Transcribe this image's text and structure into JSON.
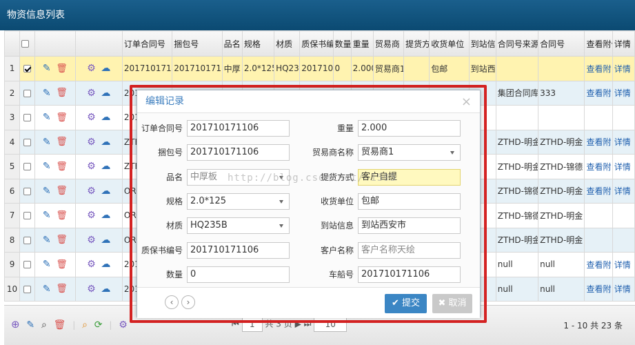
{
  "panel": {
    "title": "物资信息列表"
  },
  "grid": {
    "headers": [
      "",
      "",
      "",
      "",
      "订单合同号",
      "捆包号",
      "品名",
      "规格",
      "材质",
      "质保书编",
      "数量",
      "重量",
      "贸易商",
      "提货方",
      "收货单位",
      "到站信",
      "合同号来源",
      "合同号",
      "查看附件",
      "详情"
    ],
    "rows": [
      {
        "n": "1",
        "checked": true,
        "cells": [
          "2017101711",
          "2017101711",
          "中厚",
          "2.0*125",
          "HQ23",
          "201710",
          "0",
          "2.000",
          "贸易商1",
          "",
          "包邮",
          "到站西",
          "",
          "",
          "查看附",
          "详情"
        ],
        "cls": "sel"
      },
      {
        "n": "2",
        "checked": false,
        "cells": [
          "201",
          "",
          "",
          "",
          "",
          "",
          "",
          "",
          "",
          "",
          "",
          "",
          "集团合同库",
          "333",
          "查看附",
          "详情"
        ],
        "cls": "even"
      },
      {
        "n": "3",
        "checked": false,
        "cells": [
          "201",
          "",
          "",
          "",
          "",
          "",
          "",
          "",
          "",
          "",
          "",
          "",
          "",
          "",
          "",
          ""
        ],
        "cls": "odd"
      },
      {
        "n": "4",
        "checked": false,
        "cells": [
          "ZTH",
          "",
          "",
          "",
          "",
          "",
          "",
          "",
          "",
          "",
          "",
          "",
          "ZTHD-明金",
          "ZTHD-明金",
          "查看附",
          "详情"
        ],
        "cls": "even"
      },
      {
        "n": "5",
        "checked": false,
        "cells": [
          "ZTH",
          "",
          "",
          "",
          "",
          "",
          "",
          "",
          "",
          "",
          "",
          "",
          "ZTHD-明金",
          "ZTHD-锦德",
          "查看附",
          "详情"
        ],
        "cls": "odd"
      },
      {
        "n": "6",
        "checked": false,
        "cells": [
          "ORC",
          "",
          "",
          "",
          "",
          "",
          "",
          "",
          "",
          "",
          "",
          "",
          "ZTHD-锦德",
          "ZTHD-明金",
          "查看附",
          "详情"
        ],
        "cls": "even"
      },
      {
        "n": "7",
        "checked": false,
        "cells": [
          "ORC",
          "",
          "",
          "",
          "",
          "",
          "",
          "",
          "",
          "",
          "",
          "",
          "ZTHD-锦德",
          "ZTHD-明金",
          "",
          ""
        ],
        "cls": "odd"
      },
      {
        "n": "8",
        "checked": false,
        "cells": [
          "ORC",
          "",
          "",
          "",
          "",
          "",
          "",
          "",
          "",
          "",
          "",
          "",
          "ZTHD-明金",
          "ZTHD-明金",
          "",
          ""
        ],
        "cls": "even"
      },
      {
        "n": "9",
        "checked": false,
        "cells": [
          "201",
          "",
          "",
          "",
          "",
          "",
          "",
          "",
          "",
          "",
          "",
          "",
          "null",
          "null",
          "查看附",
          "详情"
        ],
        "cls": "odd"
      },
      {
        "n": "10",
        "checked": false,
        "cells": [
          "201",
          "",
          "",
          "",
          "",
          "",
          "",
          "",
          "",
          "",
          "",
          "",
          "null",
          "null",
          "查看附",
          "详情"
        ],
        "cls": "even"
      }
    ]
  },
  "pager": {
    "page_of": "共 3 页",
    "page_input": "1",
    "page_size": "10",
    "info": "1 - 10  共 23 条"
  },
  "dialog": {
    "title": "编辑记录",
    "close": "×",
    "fields": {
      "order_no": {
        "label": "订单合同号",
        "value": "201710171106"
      },
      "weight": {
        "label": "重量",
        "value": "2.000"
      },
      "bundle_no": {
        "label": "捆包号",
        "value": "201710171106"
      },
      "trader": {
        "label": "贸易商名称",
        "value": "贸易商1"
      },
      "product": {
        "label": "品名",
        "value": "中厚板"
      },
      "pickup": {
        "label": "提货方式",
        "value": "客户自提"
      },
      "spec": {
        "label": "规格",
        "value": "2.0*125"
      },
      "receiver": {
        "label": "收货单位",
        "value": "包邮"
      },
      "material": {
        "label": "材质",
        "value": "HQ235B"
      },
      "station": {
        "label": "到站信息",
        "value": "到站西安市"
      },
      "cert_no": {
        "label": "质保书编号",
        "value": "201710171106"
      },
      "customer": {
        "label": "客户名称",
        "value": "客户名称天绘"
      },
      "quantity": {
        "label": "数量",
        "value": "0"
      },
      "vessel": {
        "label": "车船号",
        "value": "201710171106"
      }
    },
    "submit": "提交",
    "cancel": "取消"
  },
  "watermark": "http://blog.csdn.net/           1595",
  "colors": {
    "header_bg": "#0b4a72",
    "highlight": "#d42222",
    "submit": "#3b86c4"
  }
}
